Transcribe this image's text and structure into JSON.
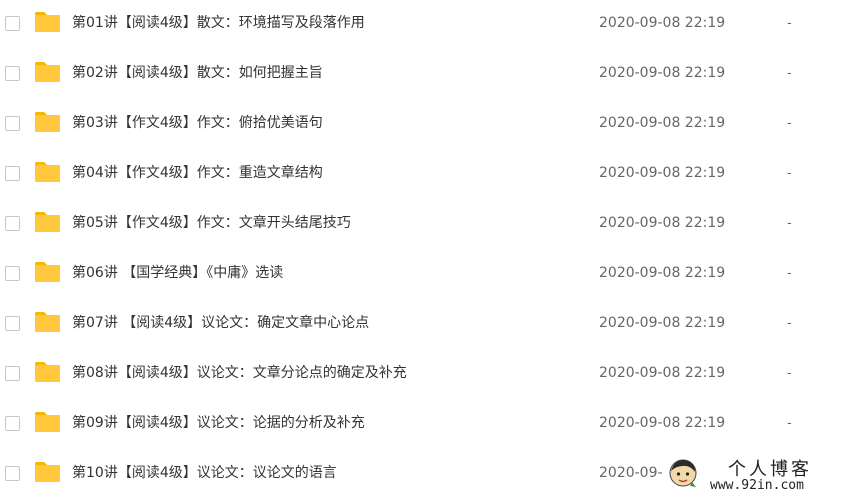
{
  "colors": {
    "folder": "#ffc83d",
    "folder_tab": "#f5b800",
    "name_text": "#333333",
    "meta_text": "#666666",
    "checkbox_border": "#c3c7cf"
  },
  "icons": {
    "row_icon": "folder-icon",
    "watermark_icon": "avatar-icon"
  },
  "files": [
    {
      "name": "第01讲【阅读4级】散文：环境描写及段落作用",
      "date": "2020-09-08 22:19",
      "size": "-"
    },
    {
      "name": "第02讲【阅读4级】散文：如何把握主旨",
      "date": "2020-09-08 22:19",
      "size": "-"
    },
    {
      "name": "第03讲【作文4级】作文：俯拾优美语句",
      "date": "2020-09-08 22:19",
      "size": "-"
    },
    {
      "name": "第04讲【作文4级】作文：重造文章结构",
      "date": "2020-09-08 22:19",
      "size": "-"
    },
    {
      "name": "第05讲【作文4级】作文：文章开头结尾技巧",
      "date": "2020-09-08 22:19",
      "size": "-"
    },
    {
      "name": "第06讲 【国学经典】《中庸》选读",
      "date": "2020-09-08 22:19",
      "size": "-"
    },
    {
      "name": "第07讲 【阅读4级】议论文：确定文章中心论点",
      "date": "2020-09-08 22:19",
      "size": "-"
    },
    {
      "name": "第08讲【阅读4级】议论文：文章分论点的确定及补充",
      "date": "2020-09-08 22:19",
      "size": "-"
    },
    {
      "name": "第09讲【阅读4级】议论文：论据的分析及补充",
      "date": "2020-09-08 22:19",
      "size": "-"
    },
    {
      "name": "第10讲【阅读4级】议论文：议论文的语言",
      "date": "2020-09-",
      "size": ""
    }
  ],
  "watermark": {
    "title": "个人博客",
    "url": "www.92in.com"
  }
}
